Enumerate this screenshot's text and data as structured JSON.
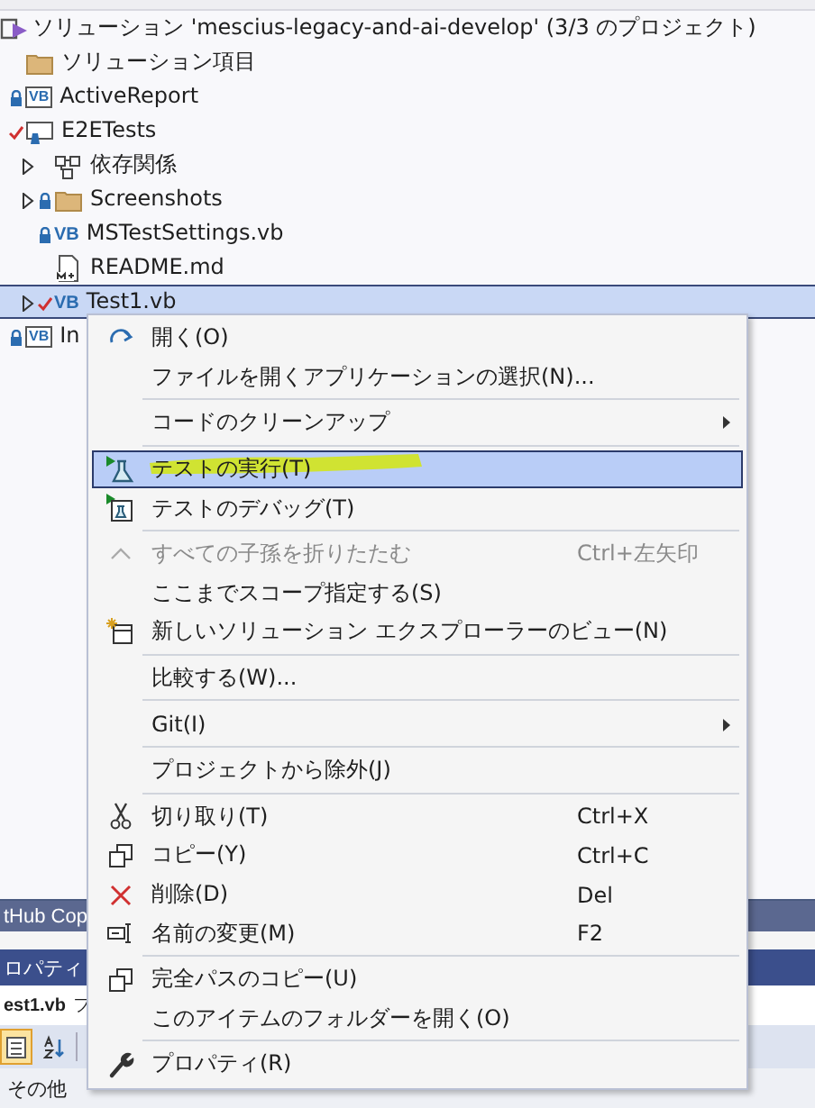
{
  "solution_explorer": {
    "solution": "ソリューション 'mescius-legacy-and-ai-develop' (3/3 のプロジェクト)",
    "items": [
      {
        "label": "ソリューション項目",
        "kind": "folder",
        "selected": false
      },
      {
        "label": "ActiveReport",
        "kind": "project",
        "badge": "VB",
        "locked": true,
        "selected": false
      },
      {
        "label": "E2ETests",
        "kind": "test-project",
        "edited": true,
        "selected": false,
        "children": [
          {
            "label": "依存関係",
            "kind": "dependencies",
            "expanded": false,
            "selected": false
          },
          {
            "label": "Screenshots",
            "kind": "folder",
            "locked": true,
            "expanded": false,
            "selected": false
          },
          {
            "label": "MSTestSettings.vb",
            "kind": "file",
            "badge": "VB",
            "locked": true,
            "selected": false
          },
          {
            "label": "README.md",
            "kind": "markdown",
            "selected": false
          },
          {
            "label": "Test1.vb",
            "kind": "file",
            "badge": "VB",
            "edited": true,
            "expanded": false,
            "selected": true
          }
        ]
      },
      {
        "label": "In",
        "kind": "project",
        "badge": "VB",
        "locked": true,
        "selected": false
      }
    ]
  },
  "properties_panel": {
    "tab": "tHub Cop",
    "title": "ロパティ",
    "object": "est1.vb",
    "object_type": "フ",
    "toolbar": [
      {
        "kind": "categorized",
        "selected": true
      },
      {
        "kind": "alphabetical",
        "selected": false
      }
    ],
    "category": "その他"
  },
  "context_menu": {
    "groups": [
      [
        {
          "label": "開く(O)",
          "kind": "open",
          "selected": false
        },
        {
          "label": "ファイルを開くアプリケーションの選択(N)...",
          "selected": false
        }
      ],
      [
        {
          "label": "コードのクリーンアップ",
          "submenu": true,
          "selected": false
        }
      ],
      [
        {
          "label": "テストの実行(T)",
          "kind": "run-test",
          "selected": true
        },
        {
          "label": "テストのデバッグ(T)",
          "kind": "debug-test",
          "selected": false
        }
      ],
      [
        {
          "label": "すべての子孫を折りたたむ",
          "kind": "collapse",
          "shortcut": "Ctrl+左矢印",
          "disabled": true,
          "selected": false
        },
        {
          "label": "ここまでスコープ指定する(S)",
          "selected": false
        },
        {
          "label": "新しいソリューション エクスプローラーのビュー(N)",
          "kind": "new-view",
          "selected": false
        }
      ],
      [
        {
          "label": "比較する(W)...",
          "selected": false
        }
      ],
      [
        {
          "label": "Git(I)",
          "submenu": true,
          "selected": false
        }
      ],
      [
        {
          "label": "プロジェクトから除外(J)",
          "selected": false
        }
      ],
      [
        {
          "label": "切り取り(T)",
          "kind": "cut",
          "shortcut": "Ctrl+X",
          "selected": false
        },
        {
          "label": "コピー(Y)",
          "kind": "copy",
          "shortcut": "Ctrl+C",
          "selected": false
        },
        {
          "label": "削除(D)",
          "kind": "delete",
          "shortcut": "Del",
          "selected": false
        },
        {
          "label": "名前の変更(M)",
          "kind": "rename",
          "shortcut": "F2",
          "selected": false
        }
      ],
      [
        {
          "label": "完全パスのコピー(U)",
          "kind": "copy",
          "selected": false
        },
        {
          "label": "このアイテムのフォルダーを開く(O)",
          "selected": false
        }
      ],
      [
        {
          "label": "プロパティ(R)",
          "kind": "properties",
          "selected": false
        }
      ]
    ]
  }
}
